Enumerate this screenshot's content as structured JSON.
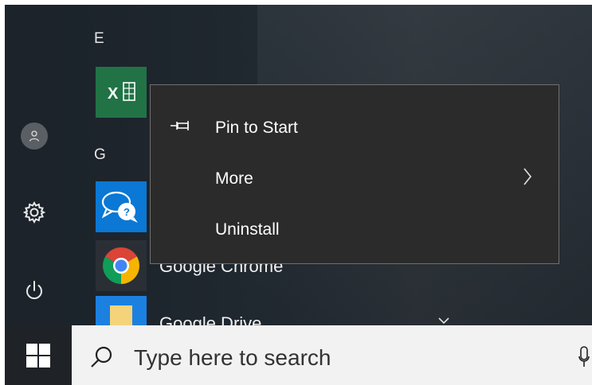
{
  "start_menu": {
    "sections": [
      {
        "letter": "E"
      },
      {
        "letter": "G"
      }
    ],
    "apps": {
      "excel": {
        "tile_glyph": "X"
      },
      "chrome": {
        "label": "Google Chrome"
      },
      "drive": {
        "label": "Google Drive"
      }
    }
  },
  "context_menu": {
    "items": [
      {
        "label": "Pin to Start",
        "icon": "pin-icon"
      },
      {
        "label": "More",
        "icon": "chevron-right-icon"
      },
      {
        "label": "Uninstall"
      }
    ]
  },
  "left_rail": {
    "icons": [
      "user-icon",
      "gear-icon",
      "power-icon"
    ]
  },
  "taskbar": {
    "search_placeholder": "Type here to search"
  },
  "colors": {
    "excel": "#217346",
    "feedback": "#0a78d4",
    "menu_bg": "#2b2b2b"
  }
}
